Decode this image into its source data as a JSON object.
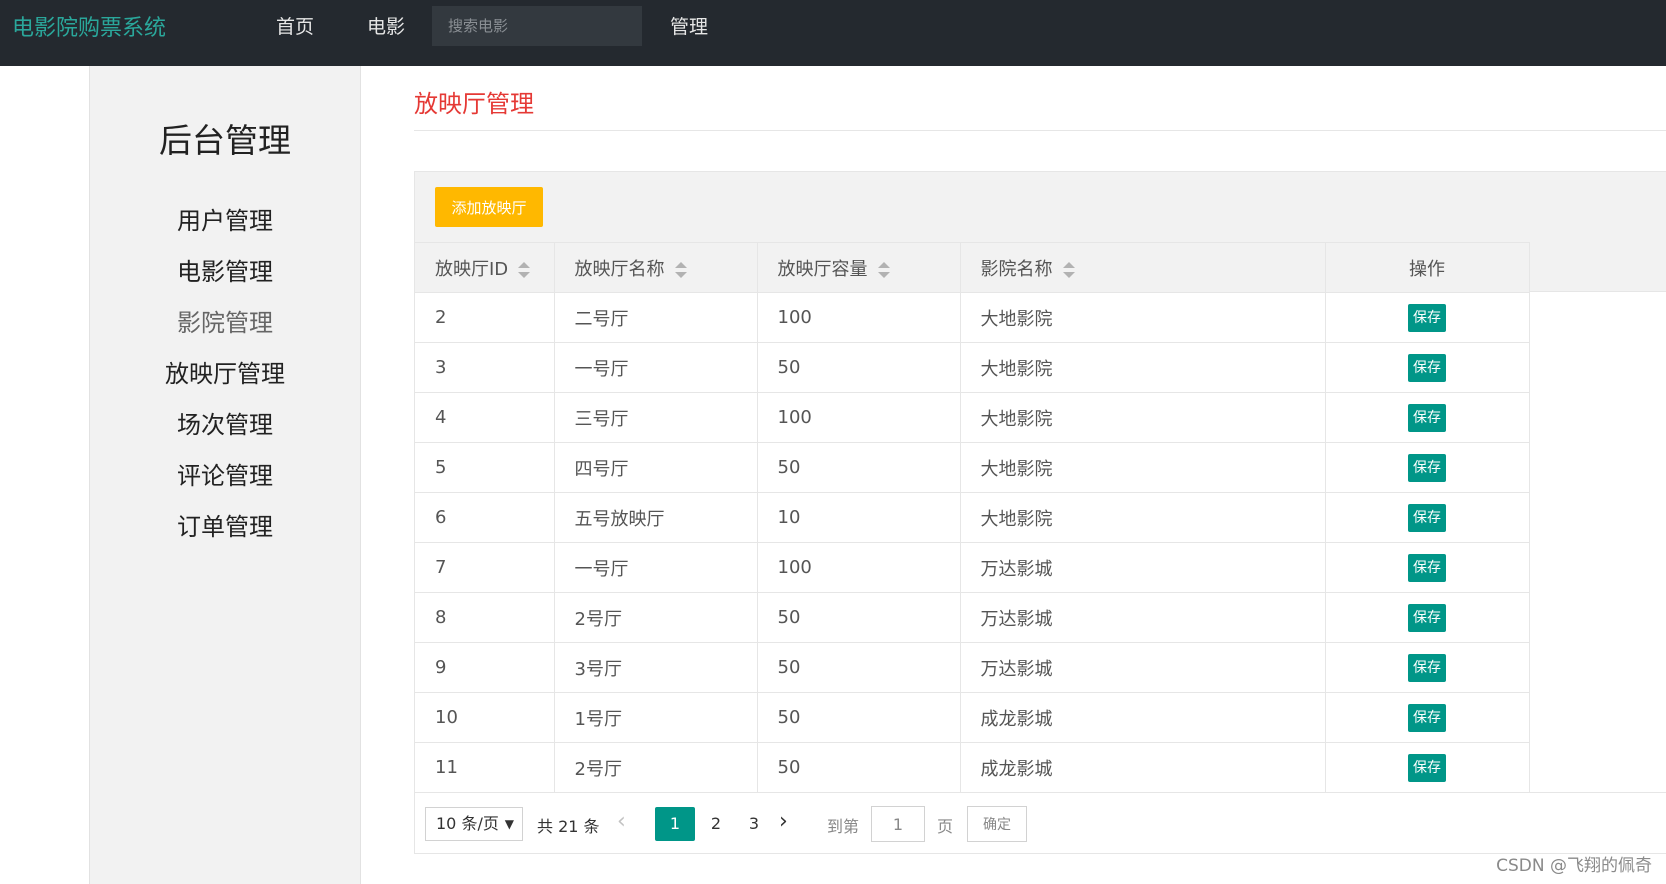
{
  "navbar": {
    "brand": "电影院购票系统",
    "home": "首页",
    "movie": "电影",
    "search_placeholder": "搜索电影",
    "admin": "管理"
  },
  "sidebar": {
    "title": "后台管理",
    "items": [
      {
        "label": "用户管理"
      },
      {
        "label": "电影管理"
      },
      {
        "label": "影院管理"
      },
      {
        "label": "放映厅管理"
      },
      {
        "label": "场次管理"
      },
      {
        "label": "评论管理"
      },
      {
        "label": "订单管理"
      }
    ]
  },
  "main": {
    "title": "放映厅管理",
    "add_button": "添加放映厅",
    "columns": [
      "放映厅ID",
      "放映厅名称",
      "放映厅容量",
      "影院名称",
      "操作"
    ],
    "save_label": "保存",
    "rows": [
      {
        "id": "2",
        "name": "二号厅",
        "capacity": "100",
        "cinema": "大地影院"
      },
      {
        "id": "3",
        "name": "一号厅",
        "capacity": "50",
        "cinema": "大地影院"
      },
      {
        "id": "4",
        "name": "三号厅",
        "capacity": "100",
        "cinema": "大地影院"
      },
      {
        "id": "5",
        "name": "四号厅",
        "capacity": "50",
        "cinema": "大地影院"
      },
      {
        "id": "6",
        "name": "五号放映厅",
        "capacity": "10",
        "cinema": "大地影院"
      },
      {
        "id": "7",
        "name": "一号厅",
        "capacity": "100",
        "cinema": "万达影城"
      },
      {
        "id": "8",
        "name": "2号厅",
        "capacity": "50",
        "cinema": "万达影城"
      },
      {
        "id": "9",
        "name": "3号厅",
        "capacity": "50",
        "cinema": "万达影城"
      },
      {
        "id": "10",
        "name": "1号厅",
        "capacity": "50",
        "cinema": "成龙影城"
      },
      {
        "id": "11",
        "name": "2号厅",
        "capacity": "50",
        "cinema": "成龙影城"
      }
    ]
  },
  "pagination": {
    "page_size": "10 条/页",
    "total": "共 21 条",
    "pages": [
      "1",
      "2",
      "3"
    ],
    "current_page": "1",
    "goto_prefix": "到第",
    "goto_value": "1",
    "goto_suffix": "页",
    "confirm": "确定"
  },
  "watermark": "CSDN @飞翔的佩奇",
  "colors": {
    "navbar_bg": "#24292f",
    "brand": "#2aa79b",
    "title_red": "#e53935",
    "add_button": "#ffb800",
    "save_button": "#009688"
  }
}
